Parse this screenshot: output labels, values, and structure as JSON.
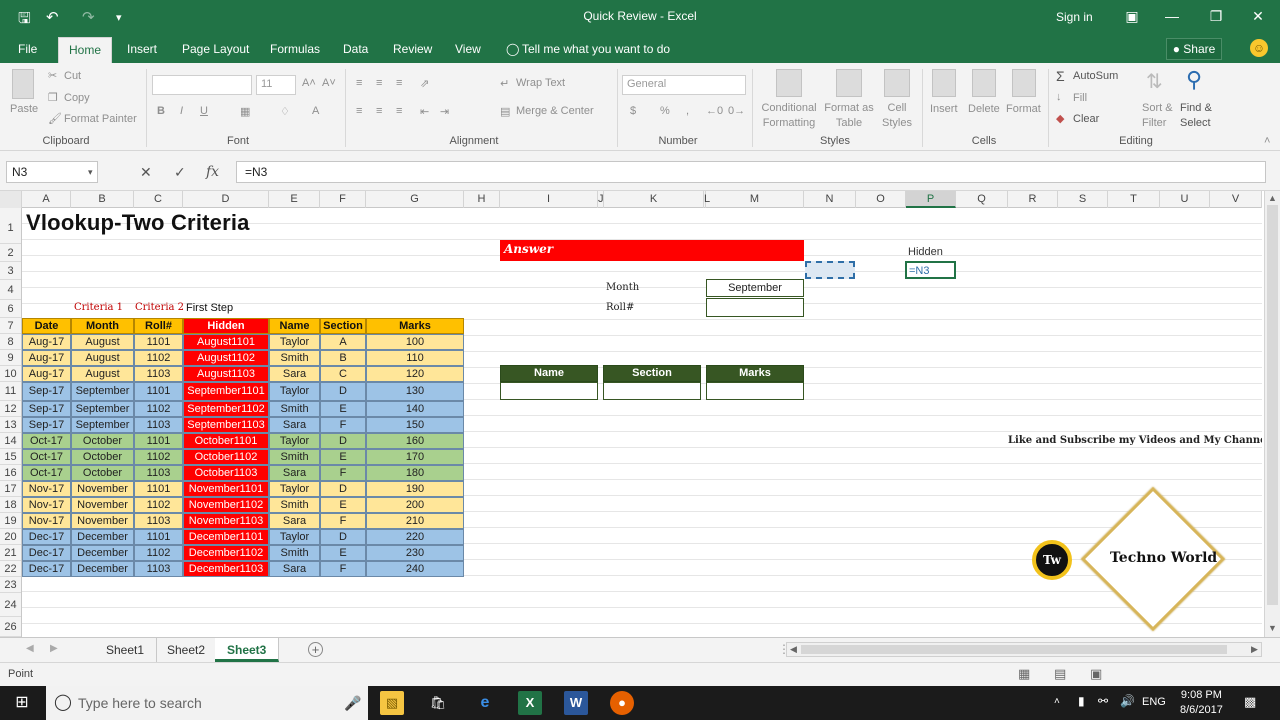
{
  "window": {
    "title": "Quick Review - Excel",
    "sign_in": "Sign in"
  },
  "tabs": [
    "File",
    "Home",
    "Insert",
    "Page Layout",
    "Formulas",
    "Data",
    "Review",
    "View"
  ],
  "tell_me": "Tell me what you want to do",
  "share": "Share",
  "ribbon": {
    "clipboard": {
      "paste": "Paste",
      "cut": "Cut",
      "copy": "Copy",
      "format_painter": "Format Painter",
      "label": "Clipboard"
    },
    "font": {
      "size": "11",
      "label": "Font"
    },
    "alignment": {
      "wrap": "Wrap Text",
      "merge": "Merge & Center",
      "label": "Alignment"
    },
    "number": {
      "format": "General",
      "label": "Number"
    },
    "styles": {
      "conditional": "Conditional Formatting",
      "format_table": "Format as Table",
      "cell_styles": "Cell Styles",
      "label": "Styles"
    },
    "cells": {
      "insert": "Insert",
      "delete": "Delete",
      "format": "Format",
      "label": "Cells"
    },
    "editing": {
      "autosum": "AutoSum",
      "fill": "Fill",
      "clear": "Clear",
      "sort": "Sort & Filter",
      "find": "Find & Select",
      "label": "Editing"
    }
  },
  "formula_bar": {
    "name_box": "N3",
    "formula": "=N3"
  },
  "columns": [
    "A",
    "B",
    "C",
    "D",
    "E",
    "F",
    "G",
    "H",
    "I",
    "J",
    "K",
    "L",
    "M",
    "N",
    "O",
    "P",
    "Q",
    "R",
    "S",
    "T",
    "U",
    "V"
  ],
  "rows": [
    "1",
    "2",
    "3",
    "4",
    "6",
    "7",
    "8",
    "9",
    "10",
    "11",
    "12",
    "13",
    "14",
    "15",
    "16",
    "17",
    "18",
    "19",
    "20",
    "21",
    "22",
    "23",
    "24",
    "26"
  ],
  "sheet": {
    "title": "Vlookup-Two Criteria",
    "criteria1": "Criteria 1",
    "criteria2": "Criteria 2",
    "first_step": "First Step",
    "headers": [
      "Date",
      "Month",
      "Roll#",
      "Hidden",
      "Name",
      "Section",
      "Marks"
    ],
    "data": [
      [
        "Aug-17",
        "August",
        "1101",
        "August1101",
        "Taylor",
        "A",
        "100"
      ],
      [
        "Aug-17",
        "August",
        "1102",
        "August1102",
        "Smith",
        "B",
        "110"
      ],
      [
        "Aug-17",
        "August",
        "1103",
        "August1103",
        "Sara",
        "C",
        "120"
      ],
      [
        "Sep-17",
        "September",
        "1101",
        "September1101",
        "Taylor",
        "D",
        "130"
      ],
      [
        "Sep-17",
        "September",
        "1102",
        "September1102",
        "Smith",
        "E",
        "140"
      ],
      [
        "Sep-17",
        "September",
        "1103",
        "September1103",
        "Sara",
        "F",
        "150"
      ],
      [
        "Oct-17",
        "October",
        "1101",
        "October1101",
        "Taylor",
        "D",
        "160"
      ],
      [
        "Oct-17",
        "October",
        "1102",
        "October1102",
        "Smith",
        "E",
        "170"
      ],
      [
        "Oct-17",
        "October",
        "1103",
        "October1103",
        "Sara",
        "F",
        "180"
      ],
      [
        "Nov-17",
        "November",
        "1101",
        "November1101",
        "Taylor",
        "D",
        "190"
      ],
      [
        "Nov-17",
        "November",
        "1102",
        "November1102",
        "Smith",
        "E",
        "200"
      ],
      [
        "Nov-17",
        "November",
        "1103",
        "November1103",
        "Sara",
        "F",
        "210"
      ],
      [
        "Dec-17",
        "December",
        "1101",
        "December1101",
        "Taylor",
        "D",
        "220"
      ],
      [
        "Dec-17",
        "December",
        "1102",
        "December1102",
        "Smith",
        "E",
        "230"
      ],
      [
        "Dec-17",
        "December",
        "1103",
        "December1103",
        "Sara",
        "F",
        "240"
      ]
    ],
    "answer_label": "Answer",
    "month_label": "Month",
    "month_value": "September",
    "roll_label": "Roll#",
    "hidden_label": "Hidden",
    "hidden_value": "=N3",
    "result_headers": [
      "Name",
      "Section",
      "Marks"
    ],
    "promo": "Like and Subscribe my Videos and My Channel",
    "logo_badge": "Tw",
    "logo_text": "Techno World"
  },
  "sheet_tabs": [
    "Sheet1",
    "Sheet2",
    "Sheet3"
  ],
  "status": "Point",
  "taskbar": {
    "search": "Type here to search",
    "lang": "ENG",
    "time": "9:08 PM",
    "date": "8/6/2017"
  },
  "colors": {
    "excel_green": "#217346",
    "header_orange": "#ffc000",
    "red": "#ff0000",
    "yellow": "#ffe699",
    "blue": "#9dc3e6",
    "green": "#a9d08e",
    "dark_green": "#375623"
  }
}
